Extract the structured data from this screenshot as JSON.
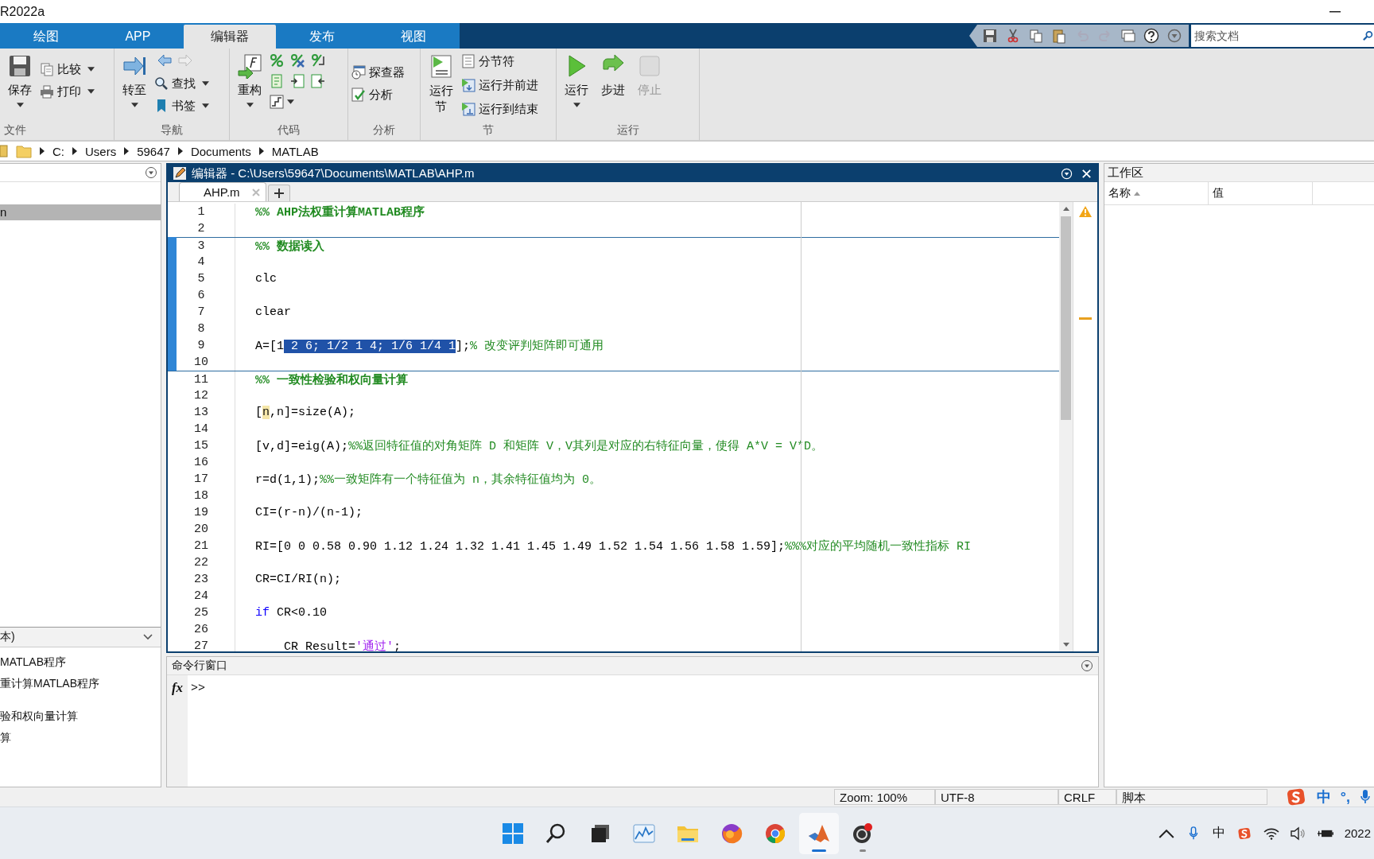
{
  "app_title": "R2022a",
  "tabs": [
    {
      "label": "绘图",
      "selected": false
    },
    {
      "label": "APP",
      "selected": false
    },
    {
      "label": "编辑器",
      "selected": true
    },
    {
      "label": "发布",
      "selected": false
    },
    {
      "label": "视图",
      "selected": false
    }
  ],
  "search": {
    "placeholder": "搜索文档"
  },
  "ribbon": {
    "groups": [
      {
        "title": "文件",
        "items": [
          {
            "label": "保存"
          },
          {
            "label": "比较"
          },
          {
            "label": "打印"
          }
        ]
      },
      {
        "title": "导航",
        "items": [
          {
            "label": "转至"
          },
          {
            "label": "查找"
          },
          {
            "label": "书签"
          }
        ]
      },
      {
        "title": "代码",
        "items": [
          {
            "label": "重构"
          }
        ]
      },
      {
        "title": "分析",
        "items": [
          {
            "label": "探查器"
          },
          {
            "label": "分析"
          }
        ]
      },
      {
        "title": "节",
        "items": [
          {
            "label": "运行节"
          },
          {
            "label": "分节符"
          },
          {
            "label": "运行并前进"
          },
          {
            "label": "运行到结束"
          }
        ]
      },
      {
        "title": "运行",
        "items": [
          {
            "label": "运行",
            "disabled": false
          },
          {
            "label": "步进",
            "disabled": false
          },
          {
            "label": "停止",
            "disabled": true
          }
        ]
      }
    ]
  },
  "address": [
    "C:",
    "Users",
    "59647",
    "Documents",
    "MATLAB"
  ],
  "file_browser": {
    "selected_row": "n",
    "details_header": "本)",
    "details": [
      "MATLAB程序",
      "重计算MATLAB程序",
      "验和权向量计算",
      "算"
    ]
  },
  "editor": {
    "title": "编辑器 - C:\\Users\\59647\\Documents\\MATLAB\\AHP.m",
    "tabs": [
      {
        "label": "AHP.m",
        "selected": true
      }
    ],
    "lines": [
      {
        "number": "1",
        "current": false,
        "section_start": false,
        "segments": [
          {
            "kind": "section",
            "text": "%% AHP法权重计算MATLAB程序"
          }
        ]
      },
      {
        "number": "2",
        "current": false,
        "section_start": false
      },
      {
        "number": "3",
        "current": true,
        "section_start": true,
        "segments": [
          {
            "kind": "section",
            "text": "%% 数据读入"
          }
        ]
      },
      {
        "number": "4",
        "current": true,
        "section_start": false
      },
      {
        "number": "5",
        "current": true,
        "section_start": false,
        "segments": [
          {
            "kind": "code",
            "text": "clc"
          }
        ]
      },
      {
        "number": "6",
        "current": true,
        "section_start": false
      },
      {
        "number": "7",
        "current": true,
        "section_start": false,
        "segments": [
          {
            "kind": "code",
            "text": "clear"
          }
        ]
      },
      {
        "number": "8",
        "current": true,
        "section_start": false
      },
      {
        "number": "9",
        "current": true,
        "section_start": false,
        "segments": [
          {
            "kind": "code",
            "text": "A=[1"
          },
          {
            "kind": "selected",
            "text": " 2 6; 1/2 1 4; 1/6 1/4 1"
          },
          {
            "kind": "code",
            "text": "];"
          },
          {
            "kind": "comment",
            "text": "% 改变评判矩阵即可通用"
          }
        ]
      },
      {
        "number": "10",
        "current": true,
        "section_start": false
      },
      {
        "number": "11",
        "current": false,
        "section_start": true,
        "segments": [
          {
            "kind": "section",
            "text": "%% 一致性检验和权向量计算"
          }
        ]
      },
      {
        "number": "12",
        "current": false,
        "section_start": false
      },
      {
        "number": "13",
        "current": false,
        "section_start": false,
        "segments": [
          {
            "kind": "code",
            "text": "["
          },
          {
            "kind": "match",
            "text": "n"
          },
          {
            "kind": "code",
            "text": ",n]=size(A);"
          }
        ]
      },
      {
        "number": "14",
        "current": false,
        "section_start": false
      },
      {
        "number": "15",
        "current": false,
        "section_start": false,
        "segments": [
          {
            "kind": "code",
            "text": "[v,d]=eig(A);"
          },
          {
            "kind": "comment",
            "text": "%%返回特征值的对角矩阵 D 和矩阵 V，V其列是对应的右特征向量，使得 A*V = V*D。"
          }
        ]
      },
      {
        "number": "16",
        "current": false,
        "section_start": false
      },
      {
        "number": "17",
        "current": false,
        "section_start": false,
        "segments": [
          {
            "kind": "code",
            "text": "r=d(1,1);"
          },
          {
            "kind": "comment",
            "text": "%%一致矩阵有一个特征值为 n，其余特征值均为 0。"
          }
        ]
      },
      {
        "number": "18",
        "current": false,
        "section_start": false
      },
      {
        "number": "19",
        "current": false,
        "section_start": false,
        "segments": [
          {
            "kind": "code",
            "text": "CI=(r-n)/(n-1);"
          }
        ]
      },
      {
        "number": "20",
        "current": false,
        "section_start": false
      },
      {
        "number": "21",
        "current": false,
        "section_start": false,
        "segments": [
          {
            "kind": "code",
            "text": "RI=[0 0 0.58 0.90 1.12 1.24 1.32 1.41 1.45 1.49 1.52 1.54 1.56 1.58 1.59];"
          },
          {
            "kind": "comment",
            "text": "%%%对应的平均随机一致性指标 RI"
          }
        ]
      },
      {
        "number": "22",
        "current": false,
        "section_start": false
      },
      {
        "number": "23",
        "current": false,
        "section_start": false,
        "segments": [
          {
            "kind": "code",
            "text": "CR=CI/RI(n);"
          }
        ]
      },
      {
        "number": "24",
        "current": false,
        "section_start": false
      },
      {
        "number": "25",
        "current": false,
        "section_start": false,
        "segments": [
          {
            "kind": "keyword",
            "text": "if"
          },
          {
            "kind": "code",
            "text": " CR<0.10"
          }
        ]
      },
      {
        "number": "26",
        "current": false,
        "section_start": false
      },
      {
        "number": "27",
        "current": false,
        "section_start": false,
        "segments": [
          {
            "kind": "code",
            "text": "    CR Result="
          },
          {
            "kind": "string",
            "text": "'通过'"
          },
          {
            "kind": "code",
            "text": ";"
          }
        ]
      }
    ]
  },
  "command_window": {
    "title": "命令行窗口",
    "fx": "fx",
    "prompt": ">>"
  },
  "workspace": {
    "title": "工作区",
    "columns": [
      "名称",
      "值"
    ]
  },
  "status_bar": [
    "Zoom: 100%",
    "UTF-8",
    "CRLF",
    "脚本"
  ],
  "ime": {
    "mode": "中",
    "punctuation": "°,"
  },
  "taskbar": {
    "apps": [
      {
        "active": false,
        "running": false
      },
      {
        "active": false,
        "running": false
      },
      {
        "active": false,
        "running": false
      },
      {
        "active": false,
        "running": false
      },
      {
        "active": false,
        "running": false
      },
      {
        "active": false,
        "running": false
      },
      {
        "active": false,
        "running": false
      },
      {
        "active": true,
        "running": true
      },
      {
        "active": false,
        "running": true
      }
    ],
    "input_mode": "中",
    "clock": "2022"
  }
}
